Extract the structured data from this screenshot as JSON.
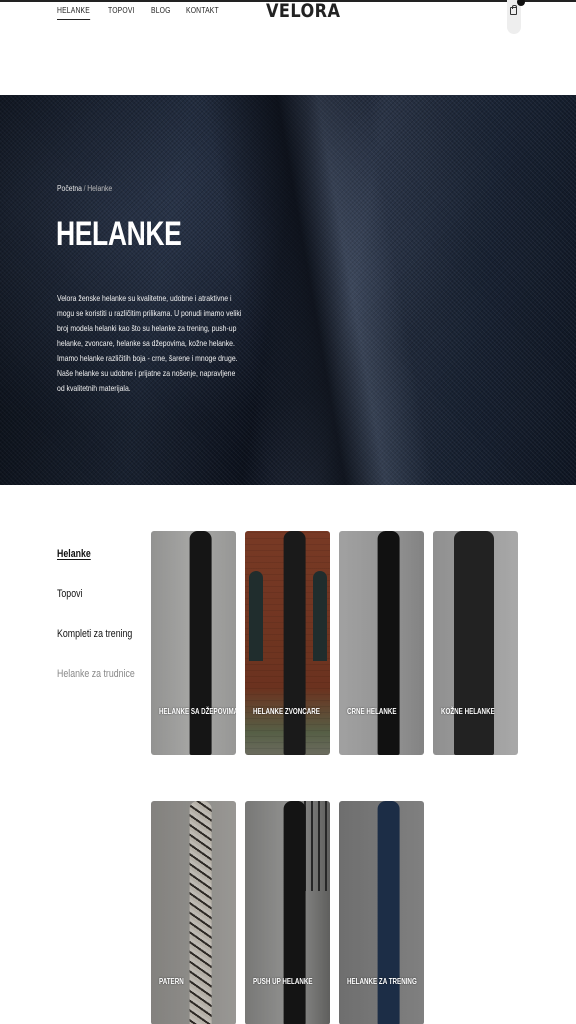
{
  "header": {
    "nav": [
      "HELANKE",
      "TOPOVI",
      "BLOG",
      "KONTAKT"
    ],
    "logo": "VELORA",
    "cart_icon": "shopping-bag-icon"
  },
  "hero": {
    "breadcrumb": {
      "home": "Početna",
      "separator": "/",
      "current": "Helanke"
    },
    "title": "HELANKE",
    "description": "Velora ženske helanke su kvalitetne, udobne i atraktivne i mogu se koristiti u različitim prilikama. U ponudi imamo veliki broj modela helanki kao što su helanke za trening, push-up helanke, zvoncare, helanke sa džepovima, kožne helanke. Imamo helanke različitih boja - crne, šarene i mnoge druge. Naše helanke su udobne i prijatne za nošenje, napravljene od kvalitetnih materijala."
  },
  "sidebar": {
    "items": [
      "Helanke",
      "Topovi",
      "Kompleti za trening",
      "Helanke za trudnice"
    ]
  },
  "products": [
    {
      "label": "HELANKE SA DŽEPOVIMA"
    },
    {
      "label": "HELANKE ZVONCARE"
    },
    {
      "label": "CRNE HELANKE"
    },
    {
      "label": "KOŽNE HELANKE"
    },
    {
      "label": "PATERN"
    },
    {
      "label": "PUSH UP HELANKE"
    },
    {
      "label": "HELANKE ZA TRENING"
    }
  ]
}
